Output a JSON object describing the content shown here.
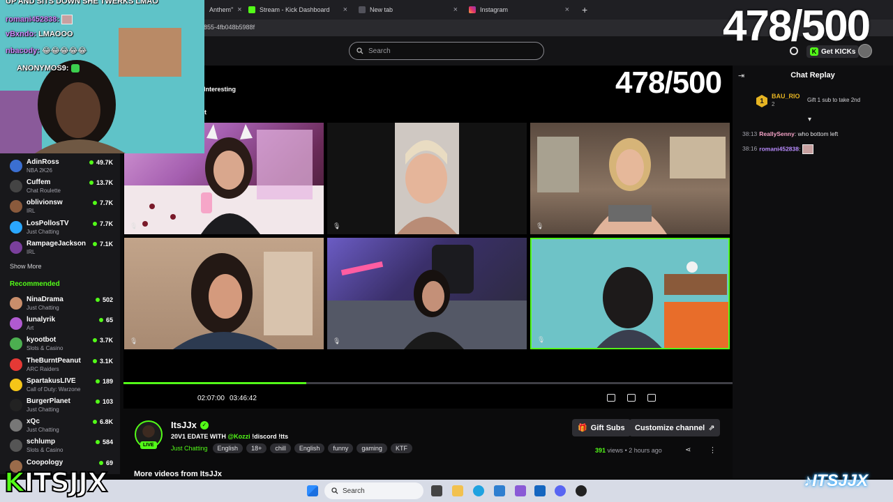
{
  "browser": {
    "tabs": [
      {
        "label": "Anthem\"",
        "color": "#555"
      },
      {
        "label": "Stream - Kick Dashboard",
        "color": "#53fc18"
      },
      {
        "label": "New tab",
        "color": "#666"
      },
      {
        "label": "Instagram",
        "color": "#e1306c"
      }
    ],
    "new_tab_symbol": "+",
    "close_symbol": "×",
    "url": "855-4fb048b5988f"
  },
  "header": {
    "search_placeholder": "Search",
    "get_kicks_label": "Get KICKs",
    "kick_letter": "K"
  },
  "player": {
    "overlay_text_1": "Interesting",
    "overlay_text_2": "ft",
    "goal_counter": "478/500",
    "current_time": "02:07:00",
    "total_time": "03:46:42",
    "progress": 0.3,
    "mic_symbol": "🎙"
  },
  "sidebar": {
    "following": [
      {
        "name": "AdinRoss",
        "category": "NBA 2K26",
        "viewers": "49.7K",
        "color": "#3b6fd1"
      },
      {
        "name": "Cuffem",
        "category": "Chat Roulette",
        "viewers": "13.7K",
        "color": "#444"
      },
      {
        "name": "oblivionsw",
        "category": "IRL",
        "viewers": "7.7K",
        "color": "#8a5a3c"
      },
      {
        "name": "LosPollosTV",
        "category": "Just Chatting",
        "viewers": "7.7K",
        "color": "#2aa7ff"
      },
      {
        "name": "RampageJackson",
        "category": "IRL",
        "viewers": "7.1K",
        "color": "#7a3f9c"
      }
    ],
    "show_more": "Show More",
    "recommended_heading": "Recommended",
    "recommended": [
      {
        "name": "NinaDrama",
        "category": "Just Chatting",
        "viewers": "502",
        "color": "#c98e6b"
      },
      {
        "name": "lunalyrik",
        "category": "Art",
        "viewers": "65",
        "color": "#b05ad0"
      },
      {
        "name": "kyootbot",
        "category": "Slots & Casino",
        "viewers": "3.7K",
        "color": "#4caf50"
      },
      {
        "name": "TheBurntPeanut",
        "category": "ARC Raiders",
        "viewers": "3.1K",
        "color": "#e53935"
      },
      {
        "name": "SpartakusLIVE",
        "category": "Call of Duty: Warzone",
        "viewers": "189",
        "color": "#f5c518"
      },
      {
        "name": "BurgerPlanet",
        "category": "Just Chatting",
        "viewers": "103",
        "color": "#222"
      },
      {
        "name": "xQc",
        "category": "Just Chatting",
        "viewers": "6.8K",
        "color": "#777"
      },
      {
        "name": "schlump",
        "category": "Slots & Casino",
        "viewers": "584",
        "color": "#555"
      },
      {
        "name": "Coopology",
        "category": "",
        "viewers": "69",
        "color": "#9a6b4a"
      }
    ]
  },
  "chat": {
    "title": "Chat Replay",
    "pinned": {
      "rank": "1",
      "user": "BAU_RIO",
      "count": "2",
      "gift_text": "Gift 1 sub to take 2nd"
    },
    "messages": [
      {
        "time": "38:13",
        "user": "ReallySenny",
        "user_color": "#f5a3c7",
        "text": "who bottom left"
      },
      {
        "time": "38:16",
        "user": "romani452838",
        "user_color": "#b98cff",
        "text": ""
      }
    ]
  },
  "channel": {
    "name": "ItsJJx",
    "live_label": "LIVE",
    "title_prefix": "20V1 EDATE WITH",
    "title_mention": "@Kozzi",
    "title_suffix": "!discord !tts",
    "category": "Just Chatting",
    "tags": [
      "English",
      "18+",
      "chill",
      "English",
      "funny",
      "gaming",
      "KTF"
    ],
    "views": "391",
    "views_label": "views",
    "ago": "• 2 hours ago",
    "gift_subs_label": "Gift Subs",
    "customize_label": "Customize channel",
    "more_videos": "More videos from ItsJJx"
  },
  "overlay": {
    "chat_lines": [
      {
        "user": "",
        "text": "UP AND SITS DOWN SHE TWERKS LMAO"
      },
      {
        "user": "romani452838:",
        "text": ""
      },
      {
        "user": "vBxndo:",
        "text": "LMAOOO"
      },
      {
        "user": "nbacody:",
        "text": "😂😂😂😂😂"
      },
      {
        "user": "ANONYMOS9:",
        "text": ""
      }
    ],
    "goal_counter": "478/500",
    "logo_left_k": "K",
    "logo_left_rest": "ITSJJX",
    "logo_right": "ITSJJX"
  },
  "taskbar": {
    "search_label": "Search"
  }
}
